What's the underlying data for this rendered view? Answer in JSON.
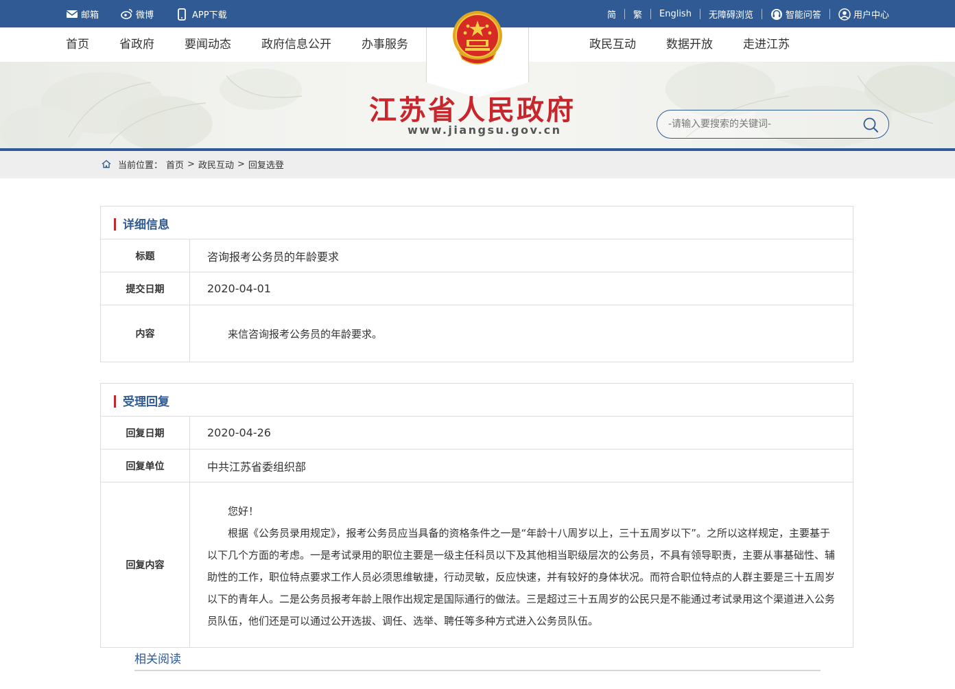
{
  "topbar": {
    "mail": "邮箱",
    "weibo": "微博",
    "app": "APP下载",
    "lang_simplified": "简",
    "lang_traditional": "繁",
    "english": "English",
    "accessibility": "无障碍浏览",
    "smart_qa": "智能问答",
    "user_center": "用户中心"
  },
  "nav": {
    "home": "首页",
    "province_gov": "省政府",
    "news": "要闻动态",
    "gov_info": "政府信息公开",
    "services": "办事服务",
    "interaction": "政民互动",
    "open_data": "数据开放",
    "about": "走进江苏"
  },
  "banner": {
    "title": "江苏省人民政府",
    "url": "www.jiangsu.gov.cn",
    "search_placeholder": "-请输入要搜索的关键词-"
  },
  "breadcrumb": {
    "label": "当前位置：",
    "items": [
      "首页",
      "政民互动",
      "回复选登"
    ],
    "separator": ">"
  },
  "detail": {
    "heading": "详细信息",
    "rows": [
      {
        "label": "标题",
        "value": "咨询报考公务员的年龄要求"
      },
      {
        "label": "提交日期",
        "value": "2020-04-01"
      },
      {
        "label": "内容",
        "value": "来信咨询报考公务员的年龄要求。"
      }
    ]
  },
  "reply": {
    "heading": "受理回复",
    "rows": [
      {
        "label": "回复日期",
        "value": "2020-04-26"
      },
      {
        "label": "回复单位",
        "value": "中共江苏省委组织部"
      }
    ],
    "content_label": "回复内容",
    "paragraphs": [
      "您好！",
      "根据《公务员录用规定》，报考公务员应当具备的资格条件之一是“年龄十八周岁以上，三十五周岁以下”。之所以这样规定，主要基于以下几个方面的考虑。一是考试录用的职位主要是一级主任科员以下及其他相当职级层次的公务员，不具有领导职责，主要从事基础性、辅助性的工作，职位特点要求工作人员必须思维敏捷，行动灵敏，反应快速，并有较好的身体状况。而符合职位特点的人群主要是三十五周岁以下的青年人。二是公务员报考年龄上限作出规定是国际通行的做法。三是超过三十五周岁的公民只是不能通过考试录用这个渠道进入公务员队伍，他们还是可以通过公开选拔、调任、选举、聘任等多种方式进入公务员队伍。"
    ]
  },
  "related": "相关阅读",
  "colors": {
    "brand_blue": "#2f5a93",
    "accent_red": "#c8262d"
  }
}
